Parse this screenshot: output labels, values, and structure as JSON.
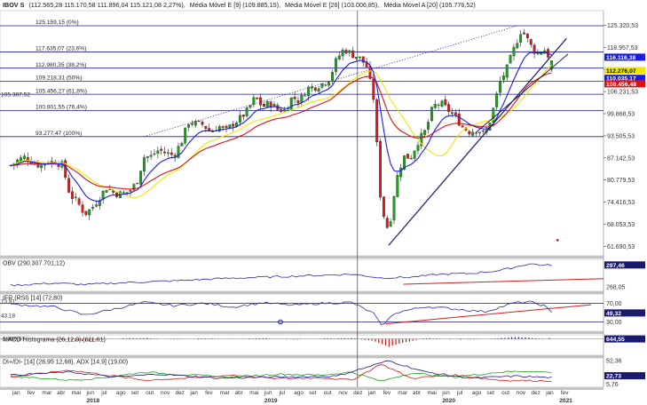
{
  "header": {
    "symbol": "IBOV S",
    "ohlc": "(112.565,28  115.170,58  111.896,04  115.121,08  2,27%),",
    "ma1": "Média Móvel E [9] (109.885,15),",
    "ma2": "Média Móvel E [26] (103.006,85),",
    "ma3": "Média Móvel A [20] (105.776,52)"
  },
  "colors": {
    "up": "#19a319",
    "down": "#d81b1b",
    "ema9": "#1a1ae6",
    "ema26": "#e01010",
    "sma20": "#f2e600",
    "trend": "#1a1a6e",
    "fib": "#1a1a99",
    "price_tag": "#1a1ae6"
  },
  "chart_data": [
    {
      "type": "candlestick",
      "panel": "price",
      "title": "IBOV S",
      "y_ticks": [
        125320.53,
        118957.53,
        112594.53,
        106231.53,
        99868.53,
        93505.53,
        87142.53,
        80779.53,
        74416.53,
        68053.53,
        61690.53
      ],
      "y_tick_labels": [
        "125.320,53",
        "118.957,53",
        "112.594,53",
        "106.231,53",
        "99.868,53",
        "93.505,53",
        "87.142,53",
        "80.779,53",
        "74.416,53",
        "68.053,53",
        "61.690,53"
      ],
      "ylim": [
        59000,
        129500
      ],
      "x_months": [
        "jan",
        "fev",
        "mar",
        "abr",
        "mai",
        "jun",
        "jul",
        "ago",
        "set",
        "out",
        "nov",
        "dez",
        "jan",
        "fev",
        "mar",
        "abr",
        "mai",
        "jun",
        "jul",
        "ago",
        "set",
        "out",
        "nov",
        "dez",
        "jan",
        "fev",
        "mar",
        "abr",
        "mai",
        "jun",
        "jul",
        "ago",
        "set",
        "out",
        "nov",
        "dez",
        "jan",
        "fev"
      ],
      "x_years": [
        "2018",
        "2019",
        "2020",
        "2021"
      ],
      "monthly_close_path": [
        [
          0,
          85000
        ],
        [
          0.5,
          86500
        ],
        [
          1,
          87500
        ],
        [
          1.5,
          85800
        ],
        [
          2,
          84900
        ],
        [
          2.5,
          86000
        ],
        [
          3,
          86100
        ],
        [
          3.5,
          85000
        ],
        [
          4,
          76500
        ],
        [
          4.5,
          74500
        ],
        [
          5,
          71000
        ],
        [
          5.5,
          72800
        ],
        [
          6,
          75900
        ],
        [
          6.5,
          78800
        ],
        [
          7,
          77000
        ],
        [
          7.5,
          76800
        ],
        [
          8,
          77500
        ],
        [
          8.5,
          80000
        ],
        [
          9,
          87400
        ],
        [
          9.5,
          87600
        ],
        [
          10,
          89500
        ],
        [
          10.5,
          88500
        ],
        [
          11,
          87900
        ],
        [
          11.5,
          91500
        ],
        [
          12,
          97400
        ],
        [
          12.5,
          97000
        ],
        [
          13,
          96700
        ],
        [
          13.5,
          94500
        ],
        [
          14,
          96400
        ],
        [
          14.5,
          94800
        ],
        [
          15,
          97000
        ],
        [
          15.5,
          98600
        ],
        [
          16,
          100900
        ],
        [
          16.5,
          104600
        ],
        [
          17,
          101800
        ],
        [
          17.5,
          103000
        ],
        [
          18,
          101100
        ],
        [
          18.5,
          100900
        ],
        [
          19,
          104700
        ],
        [
          19.5,
          103400
        ],
        [
          20,
          107200
        ],
        [
          20.5,
          107500
        ],
        [
          21,
          108400
        ],
        [
          21.5,
          109800
        ],
        [
          22,
          115600
        ],
        [
          22.5,
          118500
        ],
        [
          23,
          117000
        ],
        [
          23.5,
          116000
        ],
        [
          24,
          113800
        ],
        [
          24.5,
          104000
        ],
        [
          25,
          73000
        ],
        [
          25.5,
          66000
        ],
        [
          26,
          80500
        ],
        [
          26.5,
          87500
        ],
        [
          27,
          87400
        ],
        [
          27.5,
          92000
        ],
        [
          28,
          95000
        ],
        [
          28.5,
          102000
        ],
        [
          29,
          102900
        ],
        [
          29.5,
          101000
        ],
        [
          30,
          99000
        ],
        [
          30.5,
          96000
        ],
        [
          31,
          94600
        ],
        [
          31.5,
          95500
        ],
        [
          32,
          93500
        ],
        [
          32.5,
          100000
        ],
        [
          33,
          108900
        ],
        [
          33.5,
          113000
        ],
        [
          34,
          119000
        ],
        [
          34.5,
          124500
        ],
        [
          35,
          120000
        ],
        [
          35.5,
          117000
        ],
        [
          36,
          118400
        ],
        [
          36.5,
          115100
        ]
      ],
      "last": {
        "open": 112565.28,
        "high": 115170.58,
        "low": 111896.04,
        "close": 115121.08,
        "change_pct": 2.27
      },
      "series": [
        {
          "name": "Média Móvel E [9]",
          "last": 109885.15
        },
        {
          "name": "Média Móvel E [26]",
          "last": 103006.85
        },
        {
          "name": "Média Móvel A [20]",
          "last": 105776.52
        }
      ],
      "price_tags": [
        {
          "label": "116.116,38",
          "value": 116116.38,
          "bg": "#1a1ae6",
          "fg": "#ffffff"
        },
        {
          "label": "112.276,07",
          "value": 112276.07,
          "bg": "#f2e600",
          "fg": "#111111"
        },
        {
          "label": "110.035,17",
          "value": 110035.17,
          "bg": "#1a1ae6",
          "fg": "#ffffff"
        },
        {
          "label": "108.456,48",
          "value": 108456.48,
          "bg": "#e01010",
          "fg": "#ffffff"
        }
      ],
      "fibonacci": [
        {
          "label": "125.159,15 (0%)",
          "value": 125159.15
        },
        {
          "label": "117.635,07 (23,6%)",
          "value": 117635.07
        },
        {
          "label": "112.980,35 (38,2%)",
          "value": 112980.35
        },
        {
          "label": "109.218,31 (50%)",
          "value": 109218.31
        },
        {
          "label": "105.456,27 (61,8%)",
          "value": 105456.27
        },
        {
          "label": "100.801,55 (76,4%)",
          "value": 100801.55
        },
        {
          "label": "93.277,47 (100%)",
          "value": 93277.47
        }
      ],
      "fib_left_label": "105.387,52"
    },
    {
      "type": "line",
      "panel": "obv",
      "title": "OBV (290.307.701,12)",
      "y_tick_labels": [
        "297,46",
        "268,05"
      ],
      "ylim": [
        262,
        305
      ],
      "tag": "297,46",
      "monthly_path": [
        [
          0,
          270
        ],
        [
          3,
          273
        ],
        [
          5,
          271
        ],
        [
          8,
          274
        ],
        [
          11,
          276
        ],
        [
          14,
          279
        ],
        [
          17,
          281
        ],
        [
          20,
          283
        ],
        [
          23,
          285
        ],
        [
          25,
          280
        ],
        [
          27,
          281
        ],
        [
          29,
          285
        ],
        [
          31,
          286
        ],
        [
          33,
          290
        ],
        [
          35,
          299
        ],
        [
          36,
          297
        ],
        [
          36.5,
          297.46
        ]
      ]
    },
    {
      "type": "line",
      "panel": "rsi",
      "title": "IFR (RSI) [14] (72,80)",
      "y_tick_labels": [
        "70,00",
        "49,32",
        "30,00"
      ],
      "left_labels": [
        "73,91",
        "43,18"
      ],
      "ylim": [
        10,
        90
      ],
      "tag": "49,32",
      "monthly_path": [
        [
          0,
          68
        ],
        [
          3,
          62
        ],
        [
          5,
          45
        ],
        [
          7,
          58
        ],
        [
          9,
          72
        ],
        [
          11,
          65
        ],
        [
          13,
          70
        ],
        [
          15,
          62
        ],
        [
          17,
          71
        ],
        [
          19,
          66
        ],
        [
          21,
          70
        ],
        [
          23,
          72
        ],
        [
          24.5,
          48
        ],
        [
          25,
          22
        ],
        [
          26,
          50
        ],
        [
          28,
          63
        ],
        [
          30,
          58
        ],
        [
          32,
          52
        ],
        [
          34,
          71
        ],
        [
          35,
          73
        ],
        [
          36,
          65
        ],
        [
          36.5,
          49.32
        ]
      ]
    },
    {
      "type": "bar",
      "panel": "macd",
      "title": "MACD Histograma (26,12,9) (611,61)",
      "y_tick_labels": [
        "644,55"
      ],
      "left_labels": [
        "-2.859,57"
      ],
      "ylim": [
        -6000,
        1500
      ],
      "tag": "644,55",
      "monthly_path": [
        [
          0,
          150
        ],
        [
          2,
          -200
        ],
        [
          4,
          -600
        ],
        [
          5,
          -900
        ],
        [
          7,
          100
        ],
        [
          9,
          350
        ],
        [
          11,
          -150
        ],
        [
          13,
          200
        ],
        [
          15,
          -100
        ],
        [
          17,
          250
        ],
        [
          19,
          -200
        ],
        [
          21,
          150
        ],
        [
          23,
          300
        ],
        [
          24.5,
          -800
        ],
        [
          25.5,
          -2859.57
        ],
        [
          26.5,
          -1400
        ],
        [
          28,
          300
        ],
        [
          30,
          -200
        ],
        [
          32,
          -100
        ],
        [
          34,
          600
        ],
        [
          35,
          500
        ],
        [
          36,
          -200
        ],
        [
          36.5,
          644.55
        ]
      ]
    },
    {
      "type": "line",
      "panel": "dmi",
      "title": "DI+/DI- [14] (28,95  12,68), ADX [14,9] (19,00)",
      "y_tick_labels": [
        "52,36",
        "22,73",
        "5,76"
      ],
      "ylim": [
        0,
        58
      ],
      "tag": "22,73",
      "series": [
        {
          "name": "DI+",
          "monthly_path": [
            [
              0,
              22
            ],
            [
              4,
              14
            ],
            [
              6,
              18
            ],
            [
              9,
              30
            ],
            [
              12,
              24
            ],
            [
              15,
              20
            ],
            [
              18,
              26
            ],
            [
              21,
              24
            ],
            [
              23,
              30
            ],
            [
              25,
              12
            ],
            [
              27,
              28
            ],
            [
              30,
              20
            ],
            [
              33,
              30
            ],
            [
              35,
              32
            ],
            [
              36.5,
              28.95
            ]
          ]
        },
        {
          "name": "DI-",
          "monthly_path": [
            [
              0,
              20
            ],
            [
              4,
              34
            ],
            [
              6,
              26
            ],
            [
              9,
              14
            ],
            [
              12,
              18
            ],
            [
              15,
              24
            ],
            [
              18,
              17
            ],
            [
              21,
              19
            ],
            [
              23,
              14
            ],
            [
              25,
              46
            ],
            [
              27,
              18
            ],
            [
              30,
              24
            ],
            [
              33,
              14
            ],
            [
              35,
              13
            ],
            [
              36.5,
              12.68
            ]
          ]
        },
        {
          "name": "ADX",
          "monthly_path": [
            [
              0,
              24
            ],
            [
              4,
              30
            ],
            [
              7,
              20
            ],
            [
              10,
              26
            ],
            [
              14,
              18
            ],
            [
              18,
              20
            ],
            [
              22,
              22
            ],
            [
              25.5,
              52.36
            ],
            [
              28,
              30
            ],
            [
              31,
              18
            ],
            [
              34,
              22
            ],
            [
              36.5,
              19
            ]
          ]
        }
      ]
    }
  ]
}
